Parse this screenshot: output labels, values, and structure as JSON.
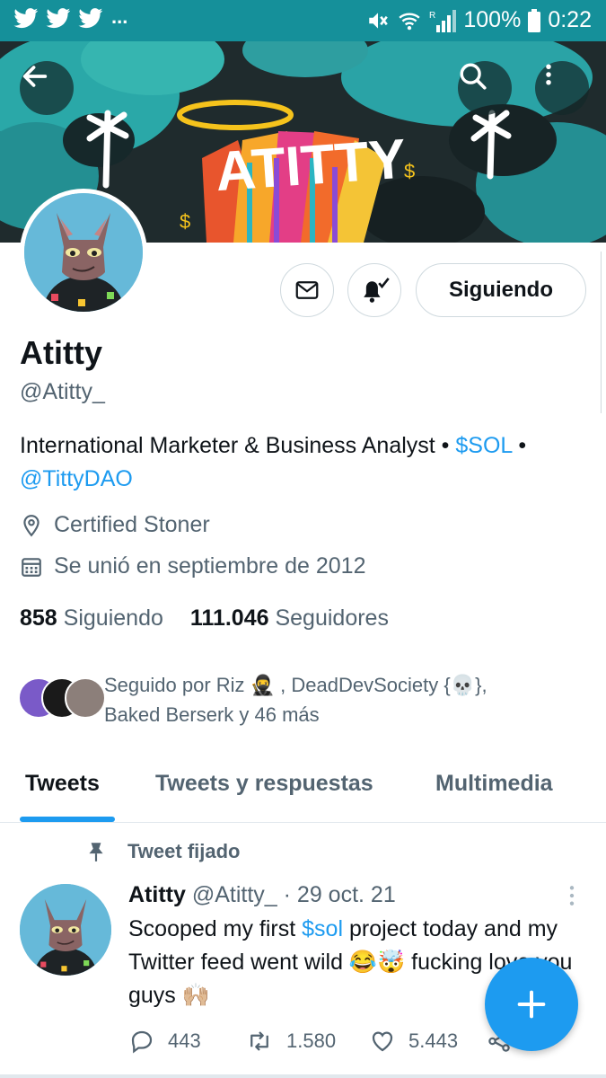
{
  "status_bar": {
    "dots": "...",
    "battery": "100%",
    "time": "0:22",
    "signal_label": "R",
    "bar_color": "#15909a"
  },
  "banner": {
    "art_text": "ATITTY",
    "back_icon": "arrow-left-icon",
    "search_icon": "search-icon",
    "more_icon": "more-vertical-icon"
  },
  "profile": {
    "name": "Atitty",
    "handle": "@Atitty_",
    "bio_text": "International Marketer & Business Analyst • ",
    "bio_link_1": "$SOL",
    "bio_sep": " • ",
    "bio_link_2": "@TittyDAO",
    "location": "Certified Stoner",
    "joined": "Se unió en septiembre de 2012",
    "following_count": "858",
    "following_label": "Siguiendo",
    "followers_count": "111.046",
    "followers_label": "Seguidores",
    "followed_by_line1": "Seguido por Riz 🥷 , DeadDevSociety {💀},",
    "followed_by_line2": "Baked Berserk y 46 más"
  },
  "actions": {
    "message_icon": "envelope-icon",
    "notify_icon": "bell-check-icon",
    "follow_label": "Siguiendo"
  },
  "tabs": [
    {
      "label": "Tweets",
      "active": true
    },
    {
      "label": "Tweets y respuestas",
      "active": false
    },
    {
      "label": "Multimedia",
      "active": false
    }
  ],
  "tweet": {
    "pinned_label": "Tweet fijado",
    "author": "Atitty",
    "handle": "@Atitty_",
    "date": " · 29 oct. 21",
    "text_1": "Scooped my first ",
    "text_link": "$sol",
    "text_2": " project today and my Twitter feed went wild 😂🤯 fucking love you guys 🙌🏼",
    "replies": "443",
    "retweets": "1.580",
    "likes": "5.443"
  },
  "colors": {
    "accent": "#1d9bf0",
    "text": "#0f1419",
    "muted": "#536471",
    "avatar_bg": "#66b9d9"
  }
}
